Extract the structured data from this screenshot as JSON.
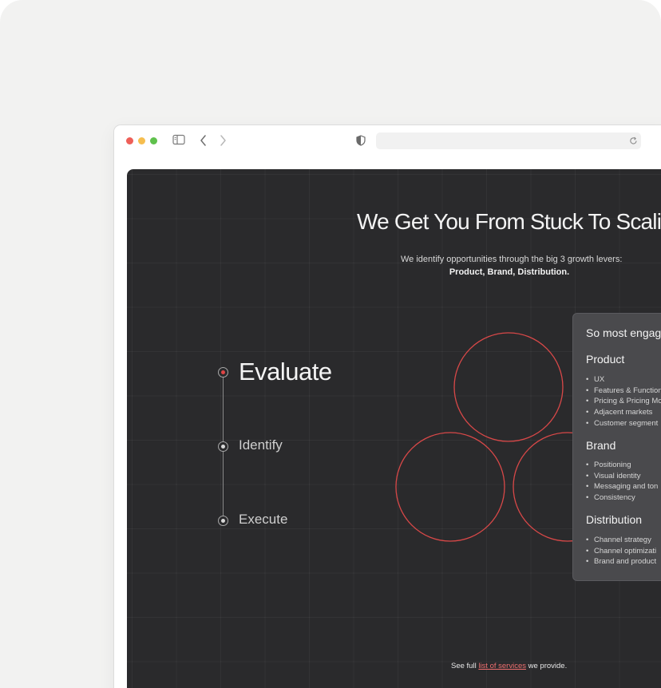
{
  "browser": {
    "icons": [
      "sidebar-toggle-icon",
      "back-arrow-icon",
      "forward-arrow-icon",
      "shield-icon",
      "reload-icon"
    ],
    "address_value": ""
  },
  "hero": {
    "headline": "We Get You From Stuck To Scaling",
    "subtitle": "We identify opportunities through the big 3 growth levers:",
    "levers": "Product, Brand, Distribution."
  },
  "steps": [
    {
      "label": "Evaluate",
      "active": true
    },
    {
      "label": "Identify",
      "active": false
    },
    {
      "label": "Execute",
      "active": false
    }
  ],
  "card": {
    "title": "So most engage",
    "sections": [
      {
        "title": "Product",
        "items": [
          "UX",
          "Features & Function",
          "Pricing & Pricing Mo",
          "Adjacent markets",
          "Customer segment"
        ]
      },
      {
        "title": "Brand",
        "items": [
          "Positioning",
          "Visual identity",
          "Messaging and ton",
          "Consistency"
        ]
      },
      {
        "title": "Distribution",
        "items": [
          "Channel strategy",
          "Channel optimizati",
          "Brand and product"
        ]
      }
    ]
  },
  "footer": {
    "prefix": "See full",
    "link": "list of services",
    "suffix": "we provide."
  },
  "colors": {
    "accent_red": "#d84848",
    "panel_bg": "#2a2a2c",
    "card_bg": "#4a4a4d"
  }
}
